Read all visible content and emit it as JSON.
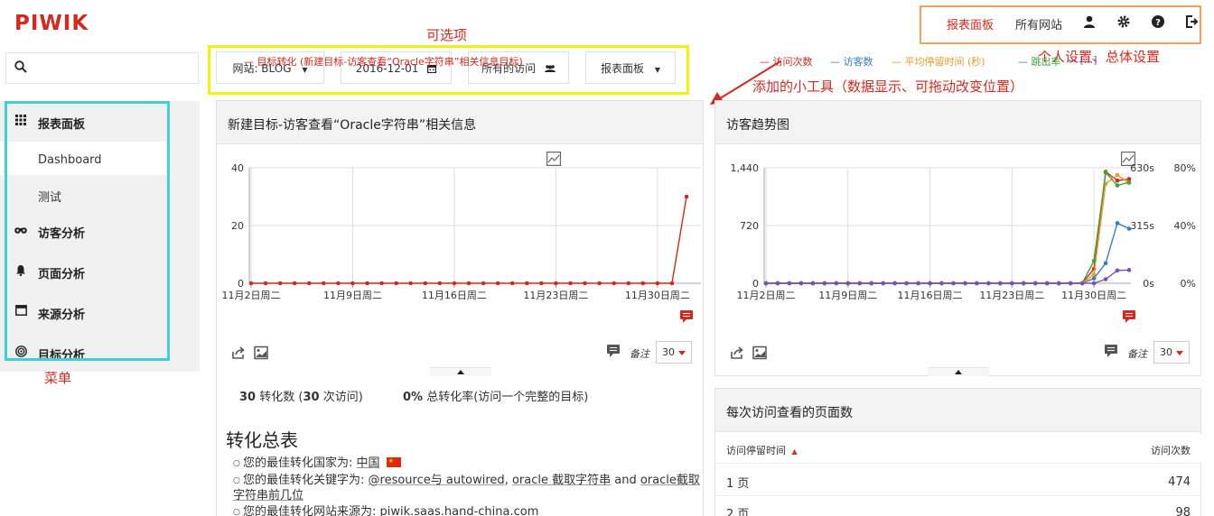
{
  "app": {
    "logo": "PIWIK"
  },
  "topnav": {
    "items": [
      {
        "label": "报表面板",
        "active": true
      },
      {
        "label": "所有网站",
        "active": false
      }
    ],
    "icons": [
      "user-icon",
      "gear-icon",
      "help-icon",
      "logout-icon"
    ],
    "accent_color": "#d4291f",
    "highlight_color": "#f0a25a"
  },
  "annotations": {
    "selectors": "可选项",
    "settings": "个人设置、总体设置",
    "widgets": "添加的小工具（数据显示、可拖动改变位置）",
    "menu": "菜单"
  },
  "search": {
    "placeholder": ""
  },
  "menu": {
    "items": [
      {
        "label": "报表面板",
        "icon": "grid-icon"
      },
      {
        "label": "访客分析",
        "icon": "binoculars-icon"
      },
      {
        "label": "页面分析",
        "icon": "bell-icon"
      },
      {
        "label": "来源分析",
        "icon": "window-icon"
      },
      {
        "label": "目标分析",
        "icon": "target-icon"
      }
    ],
    "subitems": [
      {
        "label": "Dashboard"
      },
      {
        "label": "测试"
      }
    ]
  },
  "selectors": {
    "site": "网站: BLOG",
    "date": "2016-12-01",
    "segment": "所有的访问",
    "dashboard": "报表面板"
  },
  "widget_goal": {
    "title": "新建目标-访客查看“Oracle字符串”相关信息",
    "note_label": "备注",
    "limit": "30",
    "stats": {
      "conversions_value": "30",
      "conversions_text": "转化数 (",
      "visits_value": "30",
      "visits_text": "次访问)",
      "rate_value": "0%",
      "rate_text": "总转化率(访问一个完整的目标)"
    },
    "summary_title": "转化总表",
    "summary": [
      {
        "prefix": "您的最佳转化国家为: ",
        "value": "中国"
      },
      {
        "prefix": "您的最佳转化关键字为: ",
        "value": "@resource与 autowired",
        "sep": ", ",
        "value2": "oracle 截取字符串",
        "and": " and ",
        "value3": "oracle截取字符串前几位"
      },
      {
        "prefix": "您的最佳转化网站来源为: ",
        "value": "piwik.saas.hand-china.com"
      }
    ]
  },
  "widget_trend": {
    "title": "访客趋势图",
    "note_label": "备注",
    "limit": "30"
  },
  "widget_pages": {
    "title": "每次访问查看的页面数",
    "col_left": "访问停留时间",
    "col_right": "访问次数",
    "rows": [
      {
        "label": "1 页",
        "value": "474"
      },
      {
        "label": "2 页",
        "value": "98"
      }
    ]
  },
  "chart_data": [
    {
      "type": "line",
      "legend": [
        "目标转化 (新建目标-访客查看“Oracle字符串”相关信息目标)"
      ],
      "x_ticks": [
        "11月2日周二",
        "11月9日周二",
        "11月16日周二",
        "11月23日周二",
        "11月30日周二"
      ],
      "ylim": [
        0,
        40
      ],
      "y_ticks": [
        "0",
        "20",
        "40"
      ],
      "grid": true,
      "series": [
        {
          "name": "目标转化 (新建目标-访客查看“Oracle字符串”相关信息目标)",
          "color": "#d4291f",
          "values": [
            0,
            0,
            0,
            0,
            0,
            0,
            0,
            0,
            0,
            0,
            0,
            0,
            0,
            0,
            0,
            0,
            0,
            0,
            0,
            0,
            0,
            0,
            0,
            0,
            0,
            0,
            0,
            0,
            0,
            0,
            30
          ]
        }
      ]
    },
    {
      "type": "line",
      "legend": [
        "访问次数",
        "访客数",
        "平均停留时间 (秒)",
        "跳出率",
        "[...]"
      ],
      "x_ticks": [
        "11月2日周二",
        "11月9日周二",
        "11月16日周二",
        "11月23日周二",
        "11月30日周二"
      ],
      "ylim": [
        0,
        1440
      ],
      "y_ticks": [
        "0",
        "720",
        "1,440"
      ],
      "y2_ticks": [
        "0s",
        "315s",
        "630s"
      ],
      "y3_ticks": [
        "0%",
        "40%",
        "80%"
      ],
      "grid": true,
      "series": [
        {
          "name": "访问次数",
          "color": "#d4291f",
          "values": [
            0,
            0,
            0,
            0,
            0,
            0,
            0,
            0,
            0,
            0,
            0,
            0,
            0,
            0,
            0,
            0,
            0,
            0,
            0,
            0,
            0,
            0,
            0,
            0,
            0,
            0,
            0,
            0,
            180,
            1390,
            1280,
            1300
          ]
        },
        {
          "name": "访客数",
          "color": "#3b7ec2",
          "values": [
            0,
            0,
            0,
            0,
            0,
            0,
            0,
            0,
            0,
            0,
            0,
            0,
            0,
            0,
            0,
            0,
            0,
            0,
            0,
            0,
            0,
            0,
            0,
            0,
            0,
            0,
            0,
            0,
            60,
            250,
            750,
            680
          ]
        },
        {
          "name": "平均停留时间 (秒)",
          "color": "#ee9a2d",
          "values": [
            0,
            0,
            0,
            0,
            0,
            0,
            0,
            0,
            0,
            0,
            0,
            0,
            0,
            0,
            0,
            0,
            0,
            0,
            0,
            0,
            0,
            0,
            0,
            0,
            0,
            0,
            0,
            0,
            110,
            1240,
            1350,
            1250
          ]
        },
        {
          "name": "跳出率",
          "color": "#3aa63a",
          "values": [
            0,
            0,
            0,
            0,
            0,
            0,
            0,
            0,
            0,
            0,
            0,
            0,
            0,
            0,
            0,
            0,
            0,
            0,
            0,
            0,
            0,
            0,
            0,
            0,
            0,
            0,
            0,
            0,
            280,
            1380,
            1220,
            1260
          ]
        },
        {
          "name": "[...]",
          "color": "#7b4fbb",
          "values": [
            0,
            0,
            0,
            0,
            0,
            0,
            0,
            0,
            0,
            0,
            0,
            0,
            0,
            0,
            0,
            0,
            0,
            0,
            0,
            0,
            0,
            0,
            0,
            0,
            0,
            0,
            0,
            0,
            0,
            50,
            160,
            165
          ]
        }
      ]
    }
  ]
}
